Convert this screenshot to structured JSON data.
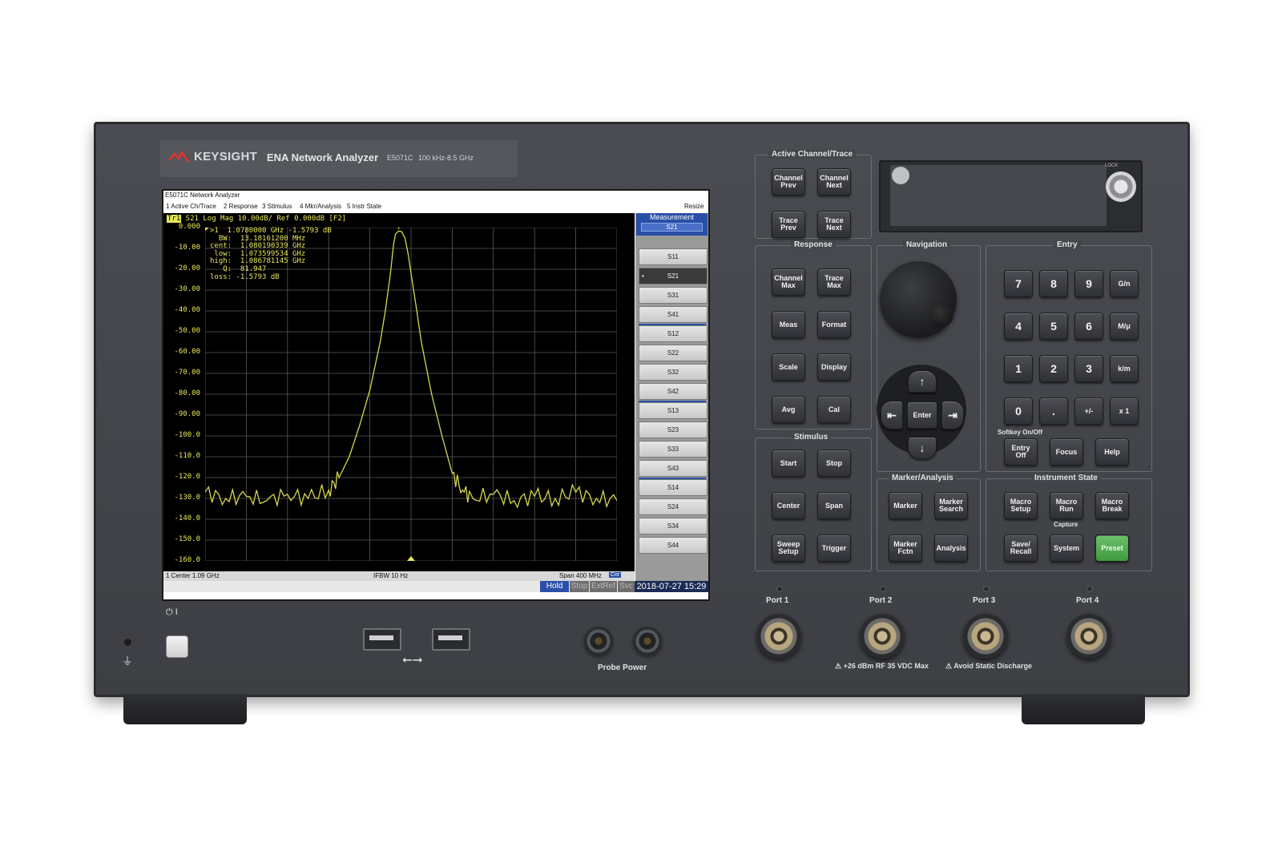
{
  "brand": {
    "logo": "KEYSIGHT",
    "title": "ENA Network Analyzer",
    "model": "E5071C",
    "range": "100 kHz-8.5 GHz"
  },
  "screen": {
    "window_title": "E5071C Network Analyzer",
    "menu": [
      "1 Active Ch/Trace",
      "2 Response",
      "3 Stimulus",
      "4 Mkr/Analysis",
      "5 Instr State"
    ],
    "resize": "Resize",
    "trace_tag": "Tr1",
    "trace_header": " S21 Log Mag 10.00dB/ Ref 0.000dB [F2]",
    "marker_lines": [
      ">1  1.0780000 GHz -1.5793 dB",
      "  BW:  13.18161200 MHz",
      "cent:  1.080190339 GHz",
      " low:  1.073599534 GHz",
      "high:  1.086781145 GHz",
      "   Q:  81.947",
      "loss: -1.5793 dB"
    ],
    "status": {
      "center": "1  Center 1.09 GHz",
      "ifbw": "IFBW 10 Hz",
      "span": "Span 400 MHz",
      "cor": "Cor"
    },
    "bottom": {
      "hold": "Hold",
      "stop": "Stop",
      "extref": "ExtRef",
      "svc": "Svc",
      "datetime": "2018-07-27 15:29"
    },
    "softkeys": {
      "title": "Measurement",
      "current": "S21",
      "items": [
        "S11",
        "S21",
        "S31",
        "S41",
        "S12",
        "S22",
        "S32",
        "S42",
        "S13",
        "S23",
        "S33",
        "S43",
        "S14",
        "S24",
        "S34",
        "S44"
      ]
    }
  },
  "chart_data": {
    "type": "line",
    "title": "",
    "xlabel": "",
    "ylabel": "",
    "y_ticks": [
      "0.000",
      "-10.00",
      "-20.00",
      "-30.00",
      "-40.00",
      "-50.00",
      "-60.00",
      "-70.00",
      "-80.00",
      "-90.00",
      "-100.0",
      "-110.0",
      "-120.0",
      "-130.0",
      "-140.0",
      "-150.0",
      "-160.0"
    ],
    "ylim": [
      -160,
      0
    ],
    "xlim_ghz": [
      0.89,
      1.29
    ],
    "grid": true,
    "series": [
      {
        "x": [
          0.89,
          0.91,
          0.93,
          0.95,
          0.97,
          0.99,
          1.01,
          1.02,
          1.03,
          1.04,
          1.05,
          1.06,
          1.065,
          1.07,
          1.073,
          1.075,
          1.078,
          1.081,
          1.084,
          1.087,
          1.09,
          1.095,
          1.1,
          1.11,
          1.12,
          1.13,
          1.14,
          1.15,
          1.17,
          1.19,
          1.21,
          1.23,
          1.25,
          1.27,
          1.29
        ],
        "y": [
          -127,
          -130,
          -129,
          -131,
          -128,
          -130,
          -126,
          -120,
          -110,
          -95,
          -78,
          -55,
          -40,
          -22,
          -8,
          -3,
          -1.6,
          -2,
          -5,
          -12,
          -22,
          -38,
          -55,
          -80,
          -100,
          -118,
          -126,
          -130,
          -128,
          -131,
          -129,
          -130,
          -127,
          -130,
          -131
        ]
      }
    ]
  },
  "panels": {
    "active": {
      "label": "Active Channel/Trace",
      "keys": [
        "Channel\nPrev",
        "Channel\nNext",
        "Trace\nPrev",
        "Trace\nNext"
      ]
    },
    "response": {
      "label": "Response",
      "keys": [
        "Channel\nMax",
        "Trace\nMax",
        "Meas",
        "Format",
        "Scale",
        "Display",
        "Avg",
        "Cal"
      ]
    },
    "stimulus": {
      "label": "Stimulus",
      "keys": [
        "Start",
        "Stop",
        "Center",
        "Span",
        "Sweep\nSetup",
        "Trigger"
      ]
    },
    "navigation": {
      "label": "Navigation",
      "up": "↑",
      "down": "↓",
      "left": "⇤",
      "right": "⇥",
      "enter": "Enter"
    },
    "entry": {
      "label": "Entry",
      "keys": [
        "7",
        "8",
        "9",
        "G/n",
        "4",
        "5",
        "6",
        "M/μ",
        "1",
        "2",
        "3",
        "k/m",
        "0",
        ".",
        "+/-",
        "x 1"
      ],
      "softkey_label": "Softkey On/Off",
      "keys2": [
        "Entry\nOff",
        "Focus",
        "Help"
      ]
    },
    "marker": {
      "label": "Marker/Analysis",
      "keys": [
        "Marker",
        "Marker\nSearch",
        "Marker\nFctn",
        "Analysis"
      ]
    },
    "instrument": {
      "label": "Instrument State",
      "keys": [
        "Macro\nSetup",
        "Macro\nRun",
        "Macro\nBreak",
        "Save/\nRecall",
        "System",
        "Preset"
      ],
      "capture": "Capture"
    }
  },
  "ports": {
    "labels": [
      "Port 1",
      "Port 2",
      "Port 3",
      "Port 4"
    ],
    "warning": "+26 dBm RF  35 VDC Max",
    "static": "Avoid Static Discharge"
  },
  "front": {
    "probe": "Probe Power",
    "lock": "LOCK",
    "power_symbol": "⏻ I",
    "usb_symbol": "⭠⭢",
    "ground": "⏚"
  }
}
